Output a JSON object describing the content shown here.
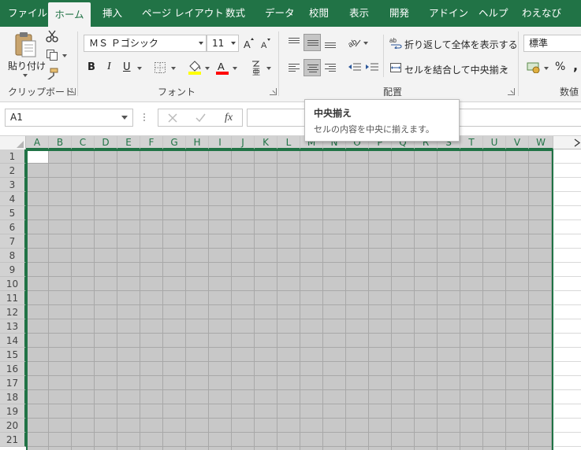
{
  "ribbon_tabs": [
    "ファイル",
    "ホーム",
    "挿入",
    "ページ レイアウト",
    "数式",
    "データ",
    "校閲",
    "表示",
    "開発",
    "アドイン",
    "ヘルプ",
    "わえなび"
  ],
  "active_tab": "ホーム",
  "clipboard": {
    "paste_label": "貼り付け",
    "group_label": "クリップボード"
  },
  "font": {
    "font_name": "ＭＳ Ｐゴシック",
    "font_size": "11",
    "bold": "B",
    "italic": "I",
    "underline": "U",
    "group_label": "フォント",
    "font_color": "#ff0000",
    "fill_color": "#ffff00"
  },
  "alignment": {
    "wrap_text_label": "折り返して全体を表示する",
    "merge_center_label": "セルを結合して中央揃え",
    "group_label": "配置"
  },
  "number": {
    "format": "標準",
    "percent": "%",
    "comma": ",",
    "group_label": "数値"
  },
  "formula_bar": {
    "name_box": "A1",
    "fx": "fx",
    "formula": ""
  },
  "columns": [
    "A",
    "B",
    "C",
    "D",
    "E",
    "F",
    "G",
    "H",
    "I",
    "J",
    "K",
    "L",
    "M",
    "N",
    "O",
    "P",
    "Q",
    "R",
    "S",
    "T",
    "U",
    "V",
    "W"
  ],
  "rows": [
    "1",
    "2",
    "3",
    "4",
    "5",
    "6",
    "7",
    "8",
    "9",
    "10",
    "11",
    "12",
    "13",
    "14",
    "15",
    "16",
    "17",
    "18",
    "19",
    "20",
    "21"
  ],
  "tooltip": {
    "title": "中央揃え",
    "description": "セルの内容を中央に揃えます。"
  },
  "colors": {
    "accent": "#217346",
    "selection_fill": "#c8c8c8"
  }
}
